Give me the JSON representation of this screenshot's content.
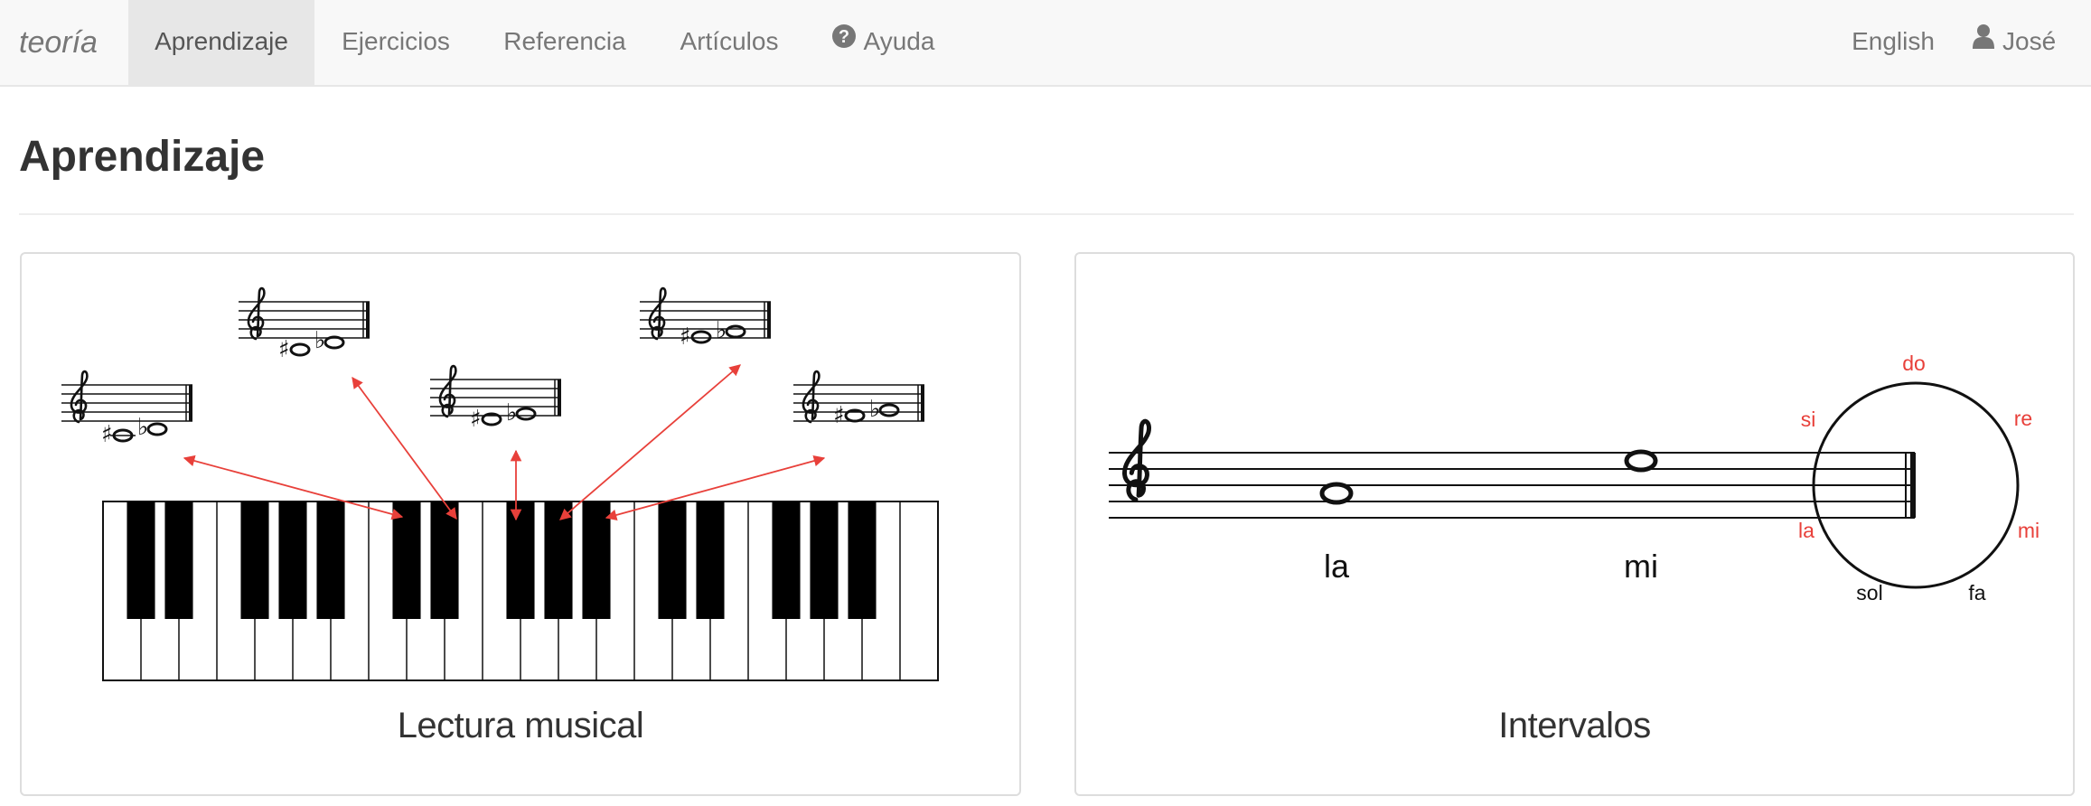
{
  "nav": {
    "brand": "teoría",
    "items": [
      {
        "label": "Aprendizaje"
      },
      {
        "label": "Ejercicios"
      },
      {
        "label": "Referencia"
      },
      {
        "label": "Artículos"
      },
      {
        "label": "Ayuda"
      }
    ],
    "language": "English",
    "user": "José"
  },
  "page": {
    "title": "Aprendizaje"
  },
  "cards": [
    {
      "caption": "Lectura musical"
    },
    {
      "caption": "Intervalos",
      "notes": [
        "la",
        "mi"
      ],
      "circle_labels": {
        "do": "do",
        "re": "re",
        "mi": "mi",
        "fa": "fa",
        "sol": "sol",
        "la": "la",
        "si": "si"
      }
    }
  ],
  "colors": {
    "accent_red": "#e8403a",
    "navbar_bg": "#f8f8f8",
    "active_tab_bg": "#e7e7e7",
    "nav_text": "#777777"
  },
  "icons": {
    "help": "question-circle-icon",
    "user": "user-icon",
    "treble_clef": "treble-clef-icon"
  }
}
